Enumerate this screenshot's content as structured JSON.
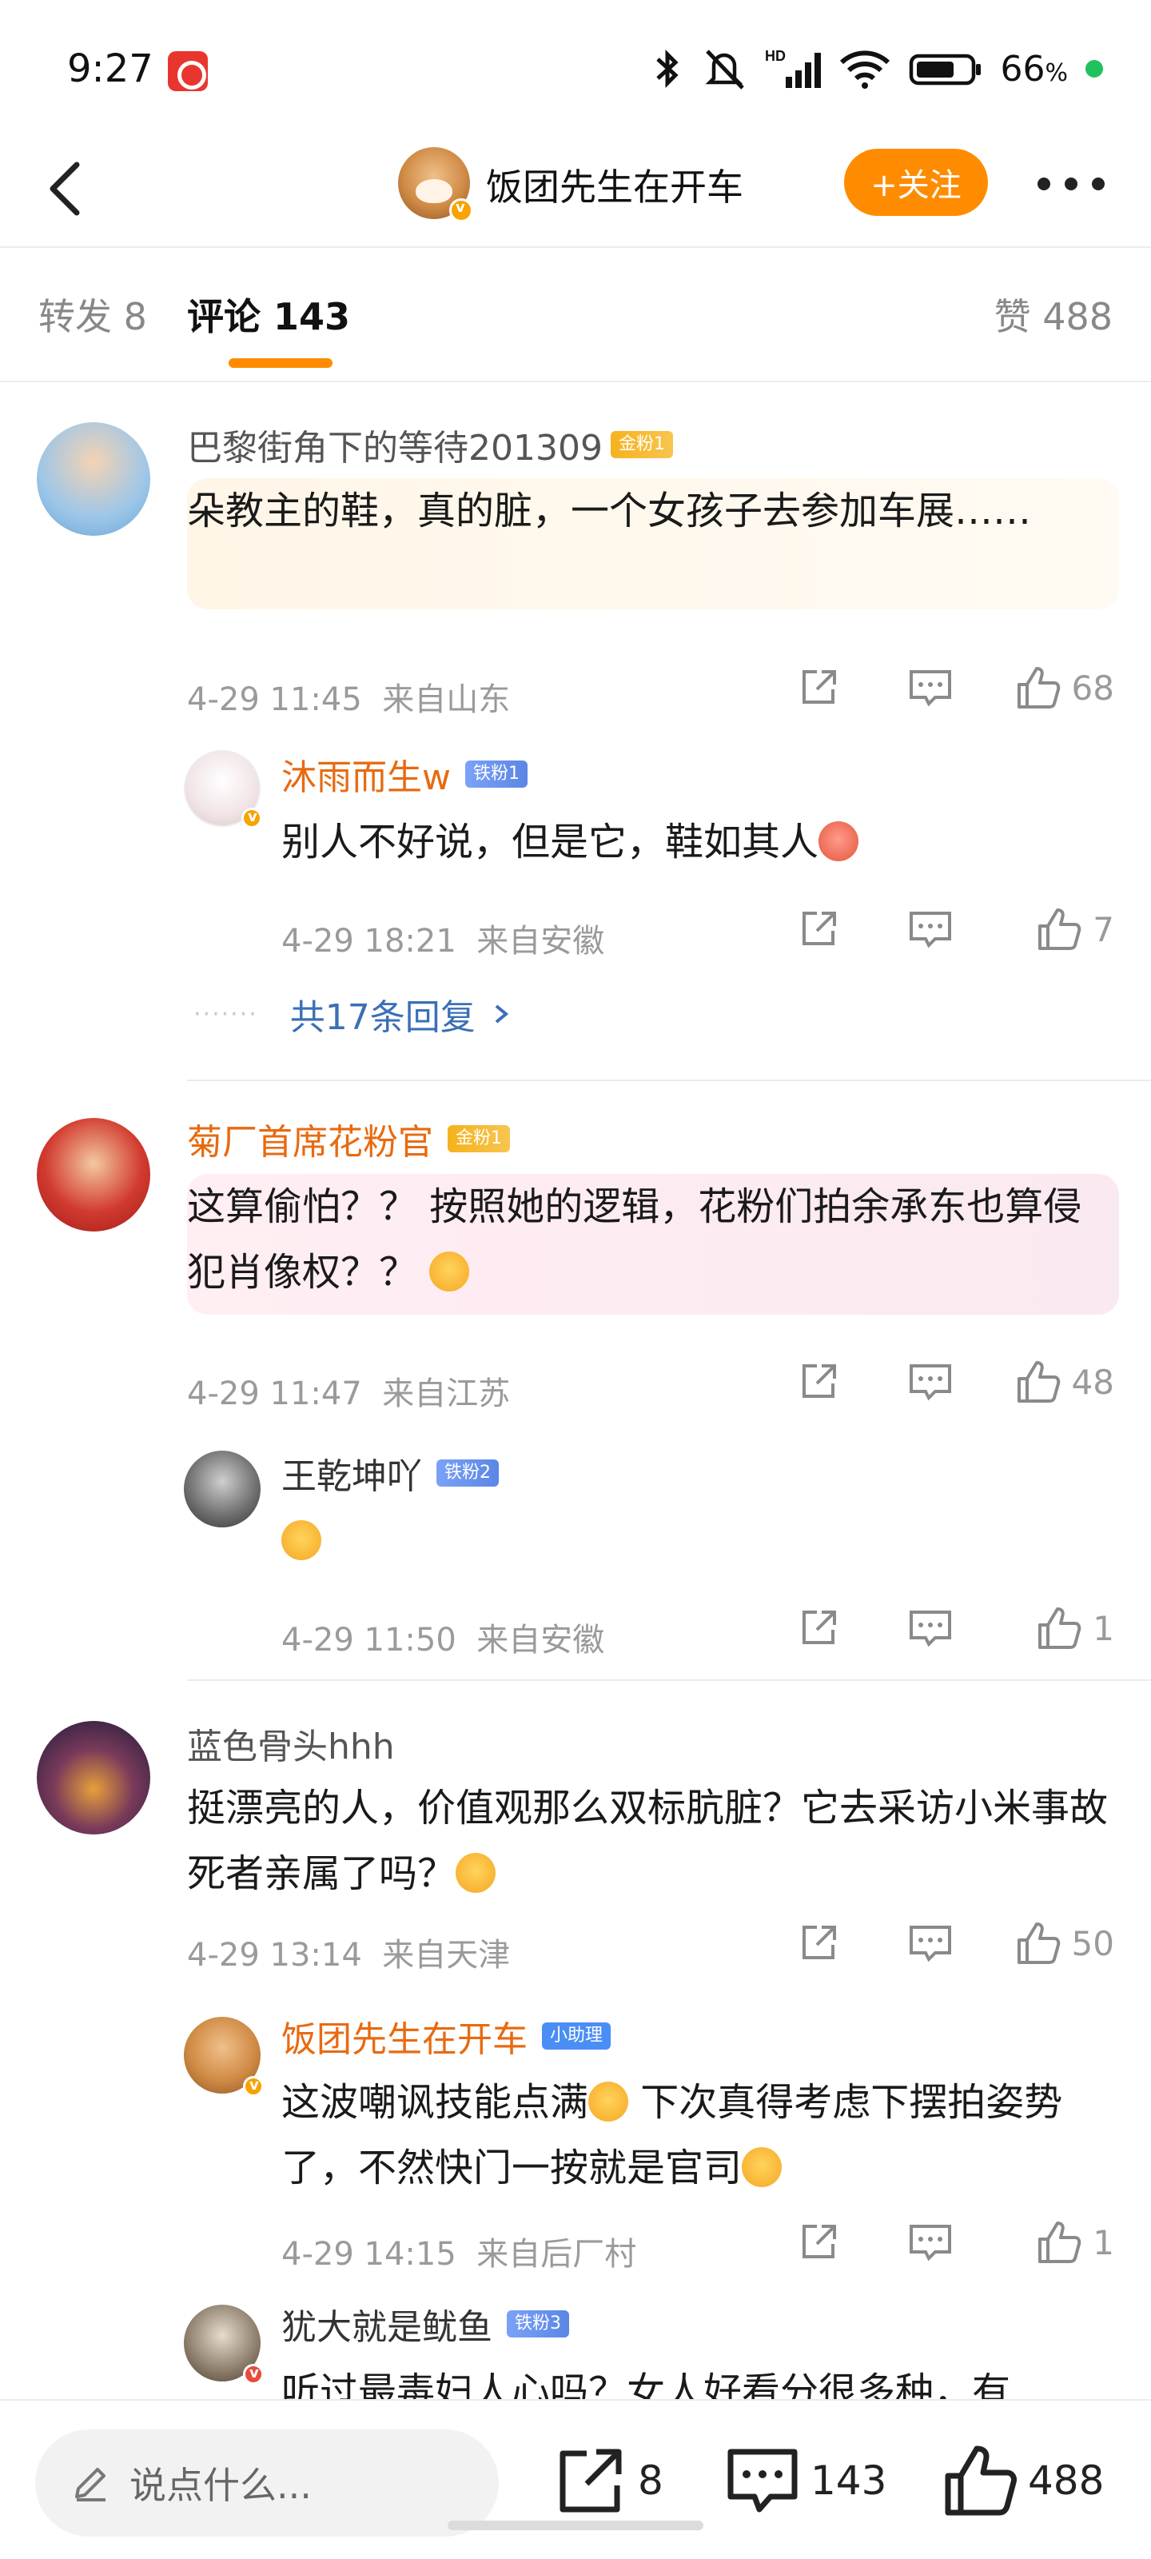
{
  "status_bar": {
    "time": "9:27",
    "battery": "66",
    "battery_unit": "%"
  },
  "header": {
    "title": "饭团先生在开车",
    "follow_label": "+关注"
  },
  "tabs": {
    "repost": "转发 8",
    "comments": "评论 143",
    "likes": "赞 488"
  },
  "comments": [
    {
      "author": "巴黎街角下的等待201309",
      "badge": "金粉1",
      "text": "朵教主的鞋，真的脏，一个女孩子去参加车展……",
      "time": "4-29 11:45",
      "location": "来自山东",
      "likes": "68",
      "replies": [
        {
          "author": "沐雨而生w",
          "badge": "铁粉1",
          "text": "别人不好说，但是它，鞋如其人",
          "time": "4-29 18:21",
          "location": "来自安徽",
          "likes": "7"
        }
      ],
      "more_replies": "共17条回复"
    },
    {
      "author": "菊厂首席花粉官",
      "badge": "金粉1",
      "text": "这算偷怕？？ 按照她的逻辑，花粉们拍余承东也算侵犯肖像权？？",
      "time": "4-29 11:47",
      "location": "来自江苏",
      "likes": "48",
      "replies": [
        {
          "author": "王乾坤吖",
          "badge": "铁粉2",
          "text": "",
          "time": "4-29 11:50",
          "location": "来自安徽",
          "likes": "1"
        }
      ]
    },
    {
      "author": "蓝色骨头hhh",
      "text": "挺漂亮的人，价值观那么双标肮脏？它去采访小米事故死者亲属了吗？",
      "time": "4-29 13:14",
      "location": "来自天津",
      "likes": "50",
      "replies": [
        {
          "author": "饭团先生在开车",
          "badge": "小助理",
          "text_a": "这波嘲讽技能点满",
          "text_b": " 下次真得考虑下摆拍姿势了，不然快门一按就是官司",
          "time": "4-29 14:15",
          "location": "来自后厂村",
          "likes": "1"
        },
        {
          "author": "犹大就是鱿鱼",
          "badge": "铁粉3",
          "text": "听过最毒妇人心吗？女人好看分很多种，有"
        }
      ]
    }
  ],
  "bottom_bar": {
    "input_placeholder": "说点什么...",
    "share_count": "8",
    "comment_count": "143",
    "like_count": "488"
  },
  "icons": [
    "back-icon",
    "more-icon",
    "share-icon",
    "comment-icon",
    "like-icon",
    "pencil-icon"
  ],
  "colors": {
    "accent": "#ff8c00",
    "link": "#3b6fb6",
    "name_highlight": "#e86a10"
  }
}
